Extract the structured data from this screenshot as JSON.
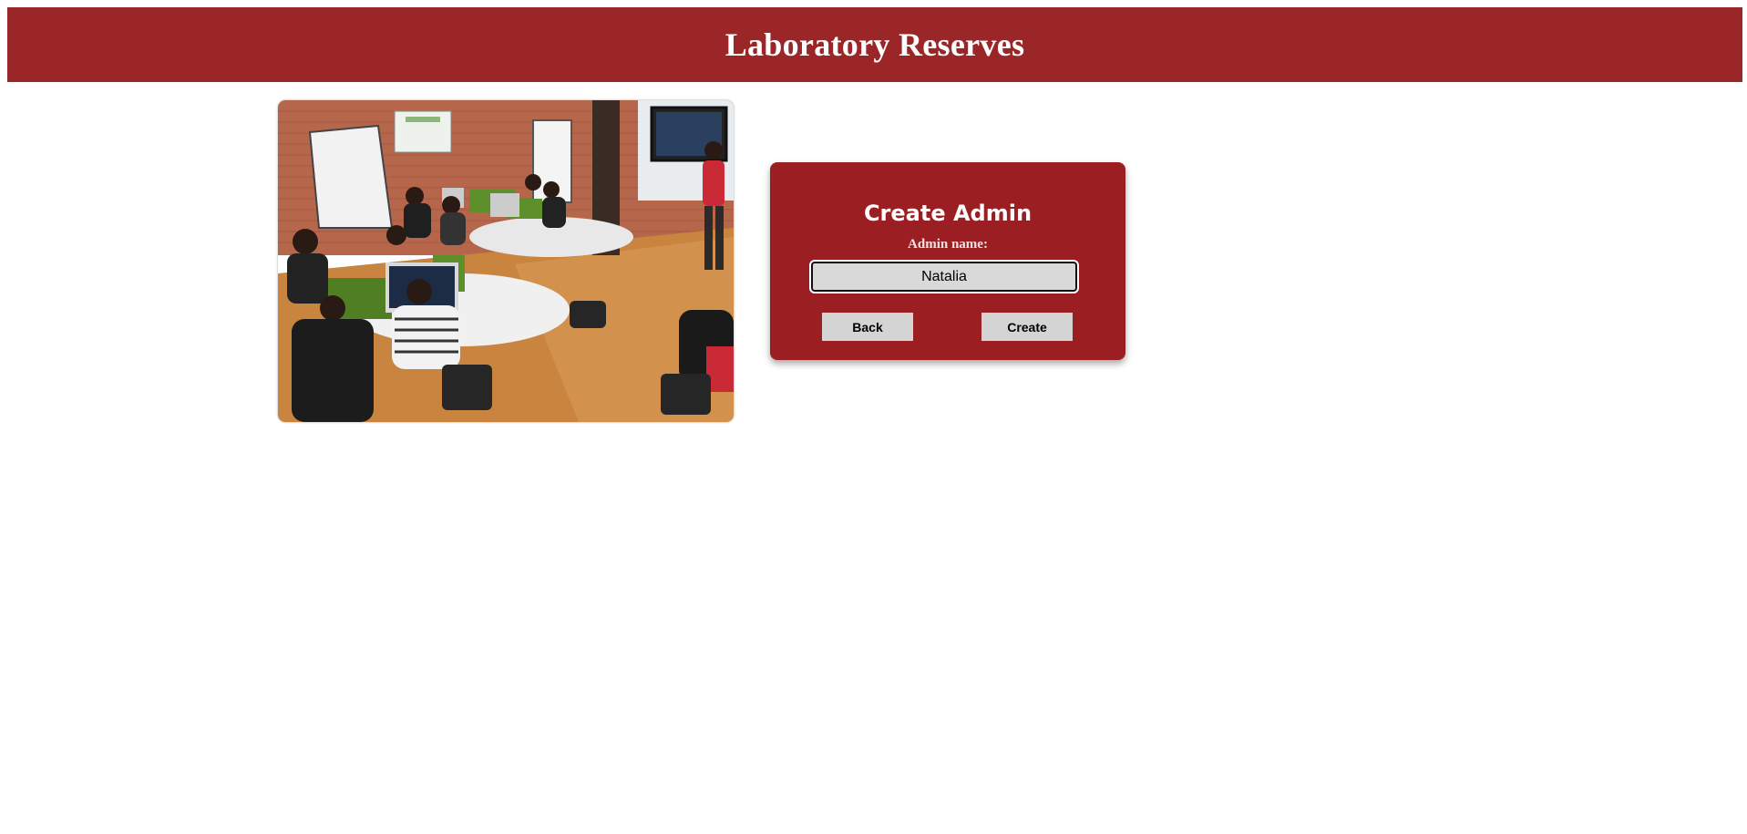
{
  "header": {
    "title": "Laboratory Reserves",
    "background_color": "#9b2628"
  },
  "hero_image": {
    "subject": "computer-lab-photo"
  },
  "create_admin_form": {
    "title": "Create Admin",
    "name_label": "Admin name:",
    "name_value": "Natalia",
    "back_label": "Back",
    "create_label": "Create",
    "card_color": "#9b1f22"
  }
}
